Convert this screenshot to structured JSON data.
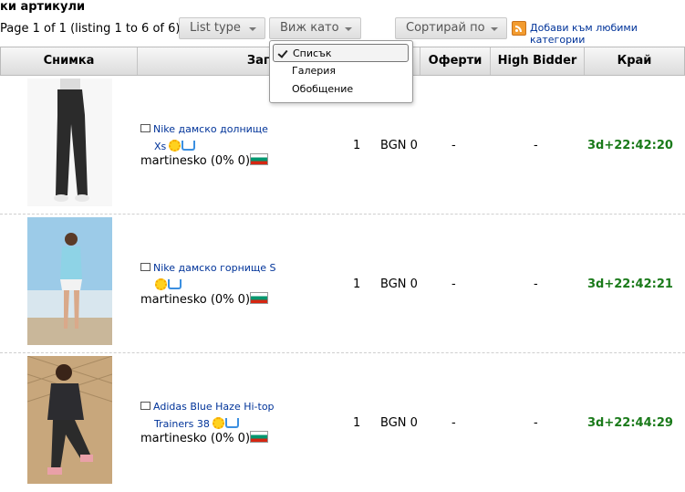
{
  "heading": "ки артикули",
  "page_info": "Page 1 of 1 (listing 1 to 6 of 6)",
  "toolbar": {
    "list_type": "List type",
    "view_as": "Виж като",
    "sort_by": "Сортирай по",
    "favorite_link": "Добави към любими категории"
  },
  "view_menu": {
    "items": [
      "Списък",
      "Галерия",
      "Обобщение"
    ],
    "selected": "Списък"
  },
  "columns": [
    "Снимка",
    "Заглавие",
    "",
    "Оферти",
    "High Bidder",
    "Край"
  ],
  "rows": [
    {
      "title_line1": "Nike дамско долнище",
      "title_line2": "Xs",
      "seller": "martinesko (0% 0)",
      "qty": "1",
      "price": "BGN 0",
      "bids": "-",
      "high_bidder": "-",
      "ends": "3d+22:42:20"
    },
    {
      "title_line1": "Nike дамско горнище S",
      "title_line2": "",
      "seller": "martinesko (0% 0)",
      "qty": "1",
      "price": "BGN 0",
      "bids": "-",
      "high_bidder": "-",
      "ends": "3d+22:42:21"
    },
    {
      "title_line1": "Adidas Blue Haze Hi-top",
      "title_line2": "Trainers 38",
      "seller": "martinesko (0% 0)",
      "qty": "1",
      "price": "BGN 0",
      "bids": "-",
      "high_bidder": "-",
      "ends": "3d+22:44:29"
    }
  ],
  "colors": {
    "link": "#003399",
    "time_left": "#1a7a1a",
    "rss": "#f29b2f"
  },
  "icons": [
    "link-icon",
    "sun-icon",
    "cart-icon",
    "bulgaria-flag-icon",
    "rss-icon",
    "checkmark-icon",
    "caret-down-icon"
  ]
}
